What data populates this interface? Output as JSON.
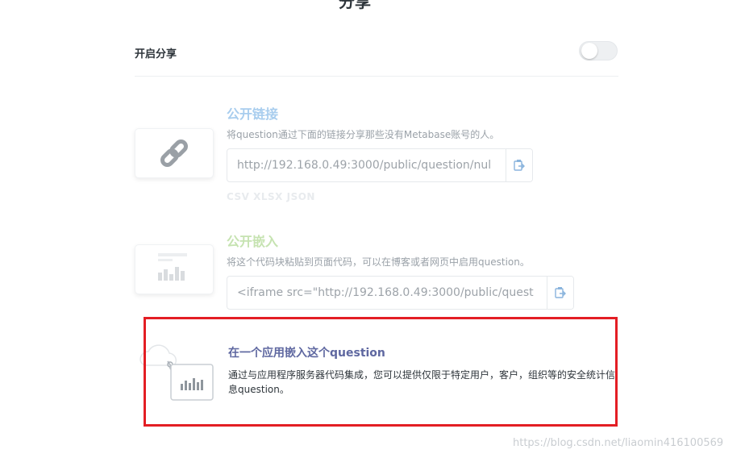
{
  "page": {
    "title": "分享"
  },
  "toggle_section": {
    "label": "开启分享",
    "enabled": false
  },
  "public_link": {
    "title": "公开链接",
    "title_color": "#a8cdee",
    "description": "将question通过下面的链接分享那些没有Metabase账号的人。",
    "url": "http://192.168.0.49:3000/public/question/nul",
    "download_formats": "CSV XLSX JSON",
    "icon": "link-icon",
    "copy_icon": "copy-icon"
  },
  "public_embed": {
    "title": "公开嵌入",
    "title_color": "#c6e3b1",
    "description": "将这个代码块粘贴到页面代码，可以在博客或者网页中启用question。",
    "code": "<iframe   src=\"http://192.168.0.49:3000/public/quest",
    "icon": "chart-embed-icon",
    "copy_icon": "copy-icon"
  },
  "app_embed": {
    "title": "在一个应用嵌入这个question",
    "description": "通过与应用程序服务器代码集成，您可以提供仅限于特定用户，客户，组织等的安全统计信息question。",
    "icon": "app-embed-icon"
  },
  "highlight_color": "#e31e24",
  "watermark": "https://blog.csdn.net/liaomin416100569"
}
